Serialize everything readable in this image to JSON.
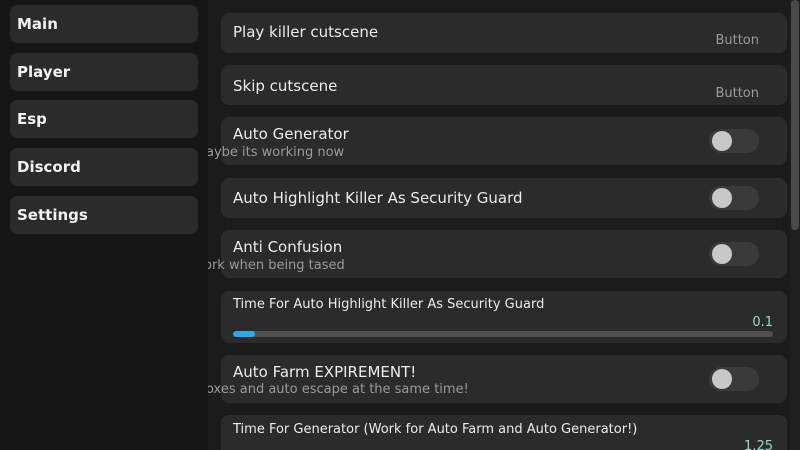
{
  "sidebar": {
    "items": [
      {
        "label": "Main"
      },
      {
        "label": "Player"
      },
      {
        "label": "Esp"
      },
      {
        "label": "Discord"
      },
      {
        "label": "Settings"
      }
    ]
  },
  "main": {
    "play_cutscene": {
      "title": "Play killer cutscene",
      "tag": "Button"
    },
    "skip_cutscene": {
      "title": "Skip cutscene",
      "tag": "Button"
    },
    "auto_generator": {
      "title": "Auto Generator",
      "desc": "aybe its working now",
      "state": "off"
    },
    "auto_highlight": {
      "title": "Auto Highlight Killer As Security Guard",
      "state": "off"
    },
    "anti_confusion": {
      "title": "Anti Confusion",
      "desc": "ork when being tased",
      "state": "off"
    },
    "highlight_time": {
      "title": "Time For Auto Highlight Killer As Security Guard",
      "value": "0.1",
      "fill_fraction": 0.04
    },
    "auto_farm": {
      "title": "Auto Farm EXPIREMENT!",
      "desc": "oxes and auto escape at the same time!",
      "state": "off"
    },
    "generator_time": {
      "title": "Time For Generator (Work for Auto Farm and Auto Generator!)",
      "value": "1.25"
    }
  },
  "colors": {
    "accent": "#2aa8f0",
    "card": "#2b2b2b",
    "background": "#1b1b1b"
  }
}
